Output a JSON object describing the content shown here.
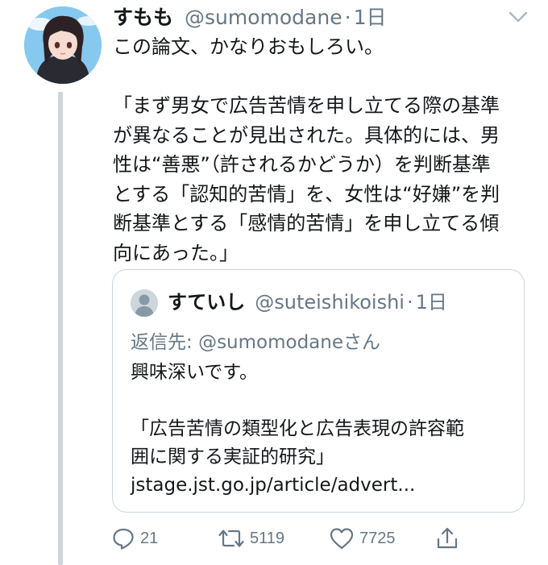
{
  "tweet": {
    "author_name": "すもも",
    "author_handle": "@sumomodane",
    "separator": "·",
    "time": "1日",
    "text_lines": [
      "この論文、かなりおもしろい。",
      "",
      "「まず男女で広告苦情を申し立てる際の基準",
      "が異なることが見出された。具体的には、男",
      "性は“善悪”（許されるかどうか）を判断基準",
      "とする「認知的苦情」を、女性は“好嫌”を判",
      "断基準とする「感情的苦情」を申し立てる傾",
      "向にあった。」"
    ]
  },
  "quote": {
    "author_name": "すていし",
    "author_handle": "@suteishikoishi",
    "separator": "·",
    "time": "1日",
    "reply_prefix": "返信先: ",
    "reply_mention": "@sumomodane",
    "reply_suffix": "さん",
    "text_lines": [
      "興味深いです。",
      "",
      "「広告苦情の類型化と広告表現の許容範",
      "囲に関する実証的研究」",
      "jstage.jst.go.jp/article/advert..."
    ]
  },
  "actions": {
    "reply_count": "21",
    "retweet_count": "5119",
    "like_count": "7725"
  },
  "icons": {
    "caret": "chevron-down-icon",
    "reply": "reply-icon",
    "retweet": "retweet-icon",
    "like": "heart-icon",
    "share": "share-icon"
  },
  "colors": {
    "text": "#14171a",
    "secondary": "#657786",
    "border": "#ccd6dd"
  }
}
